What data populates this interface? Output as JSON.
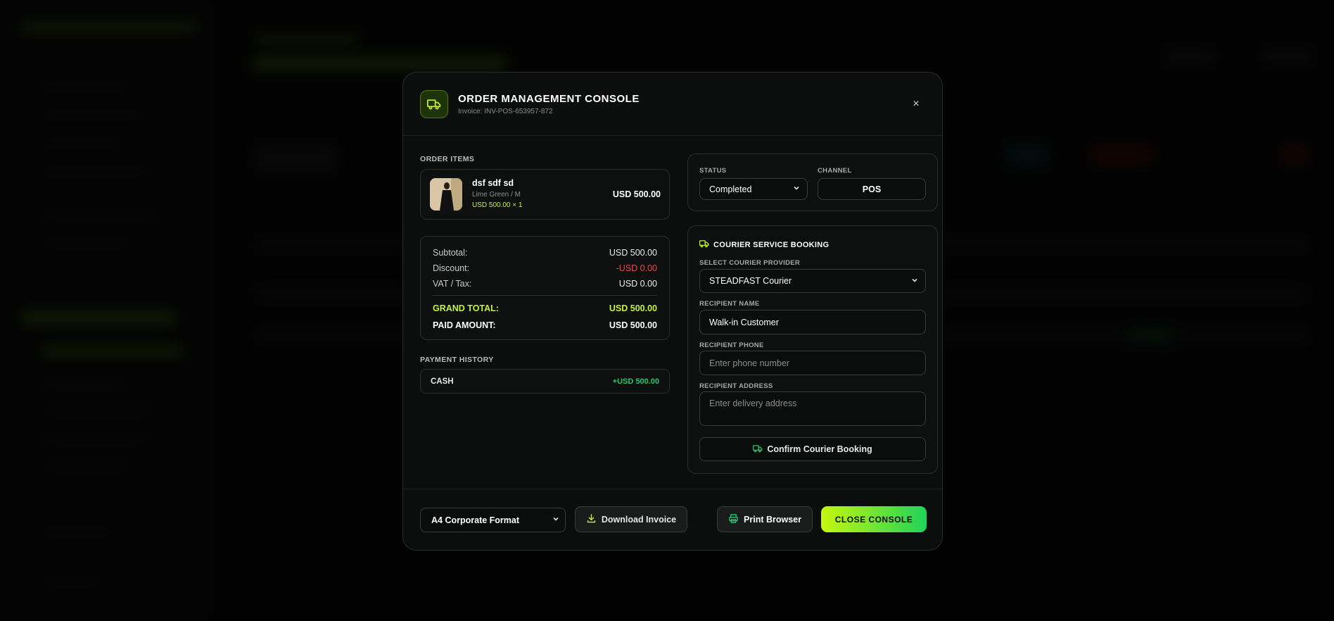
{
  "header": {
    "title": "ORDER MANAGEMENT CONSOLE",
    "invoice": "Invoice: INV-POS-653957-872",
    "close_symbol": "×"
  },
  "order_items": {
    "label": "ORDER ITEMS",
    "items": [
      {
        "name": "dsf sdf sd",
        "variant": "Lime Green / M",
        "price_qty": "USD 500.00 × 1",
        "total": "USD 500.00"
      }
    ]
  },
  "totals": {
    "subtotal_label": "Subtotal:",
    "subtotal_value": "USD 500.00",
    "discount_label": "Discount:",
    "discount_value": "-USD 0.00",
    "tax_label": "VAT / Tax:",
    "tax_value": "USD 0.00",
    "grand_label": "GRAND TOTAL:",
    "grand_value": "USD 500.00",
    "paid_label": "PAID AMOUNT:",
    "paid_value": "USD 500.00"
  },
  "payment_history": {
    "label": "PAYMENT HISTORY",
    "entries": [
      {
        "method": "CASH",
        "amount": "+USD 500.00"
      }
    ]
  },
  "status": {
    "status_label": "STATUS",
    "status_value": "Completed",
    "channel_label": "CHANNEL",
    "channel_value": "POS"
  },
  "courier": {
    "title": "COURIER SERVICE BOOKING",
    "provider_label": "SELECT COURIER PROVIDER",
    "provider_value": "STEADFAST Courier",
    "name_label": "RECIPIENT NAME",
    "name_value": "Walk-in Customer",
    "phone_label": "RECIPIENT PHONE",
    "phone_placeholder": "Enter phone number",
    "address_label": "RECIPIENT ADDRESS",
    "address_placeholder": "Enter delivery address",
    "confirm_label": "Confirm Courier Booking"
  },
  "footer": {
    "format_value": "A4 Corporate Format",
    "download_label": "Download Invoice",
    "print_label": "Print Browser",
    "close_label": "CLOSE CONSOLE"
  },
  "colors": {
    "accent": "#c6f432",
    "success": "#28c76f",
    "danger": "#ee4a4a",
    "background": "#0c0d0d"
  },
  "icons": {
    "header": "truck-icon",
    "close": "close-icon",
    "courier": "truck-icon",
    "confirm": "truck-icon",
    "download": "download-icon",
    "print": "printer-icon",
    "dropdown": "chevron-down-icon"
  }
}
